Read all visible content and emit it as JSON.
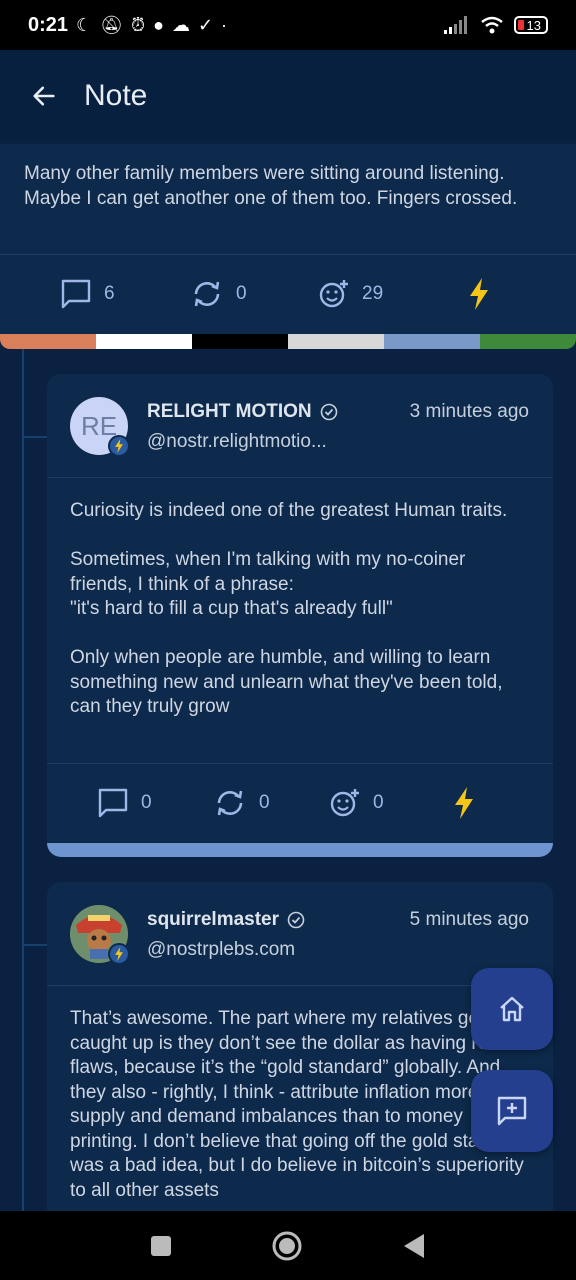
{
  "status_bar": {
    "time": "0:21",
    "battery": "13",
    "icons": [
      "moon-icon",
      "mute-icon",
      "alarm-icon",
      "chat-icon",
      "cloud-icon",
      "check-icon",
      "dot-icon",
      "signal-icon",
      "wifi-icon",
      "battery-icon"
    ]
  },
  "app_bar": {
    "title": "Note",
    "back_icon": "arrow-left-icon"
  },
  "parent_note": {
    "text": "Many other family members were sitting around listening. Maybe I can get another one of them too. Fingers crossed.",
    "replies": "6",
    "reposts": "0",
    "reactions": "29"
  },
  "stripe_colors": [
    "#d9805a",
    "#ffffff",
    "#000000",
    "#d8d8d8",
    "#7a98c8",
    "#3d8a3a"
  ],
  "replies": [
    {
      "avatar_initials": "RE",
      "name": "RELIGHT MOTION",
      "handle": "@nostr.relightmotio...",
      "time": "3 minutes ago",
      "body": "Curiosity is indeed one of the greatest Human traits.\n\nSometimes, when I'm talking with my no-coiner friends, I think of a phrase:\n\"it's hard to fill a cup that's already full\"\n\nOnly when people are humble, and willing to learn something new and unlearn what they've been told, can they truly grow",
      "replies": "0",
      "reposts": "0",
      "reactions": "0"
    },
    {
      "name": "squirrelmaster",
      "handle": "@nostrplebs.com",
      "time": "5 minutes ago",
      "body": "That’s awesome. The part where my relatives get caught up is they don’t see the dollar as having real flaws, because it’s the “gold standard” globally. And they also - rightly, I think - attribute inflation more to supply and demand imbalances than to money printing. I don’t believe that going off the gold standard was a bad idea, but I do believe in bitcoin’s superiority to all other assets"
    }
  ],
  "colors": {
    "accent": "#9fb6e6",
    "zap": "#f5c518",
    "card": "#0d2a4c",
    "background": "#0a2142"
  }
}
